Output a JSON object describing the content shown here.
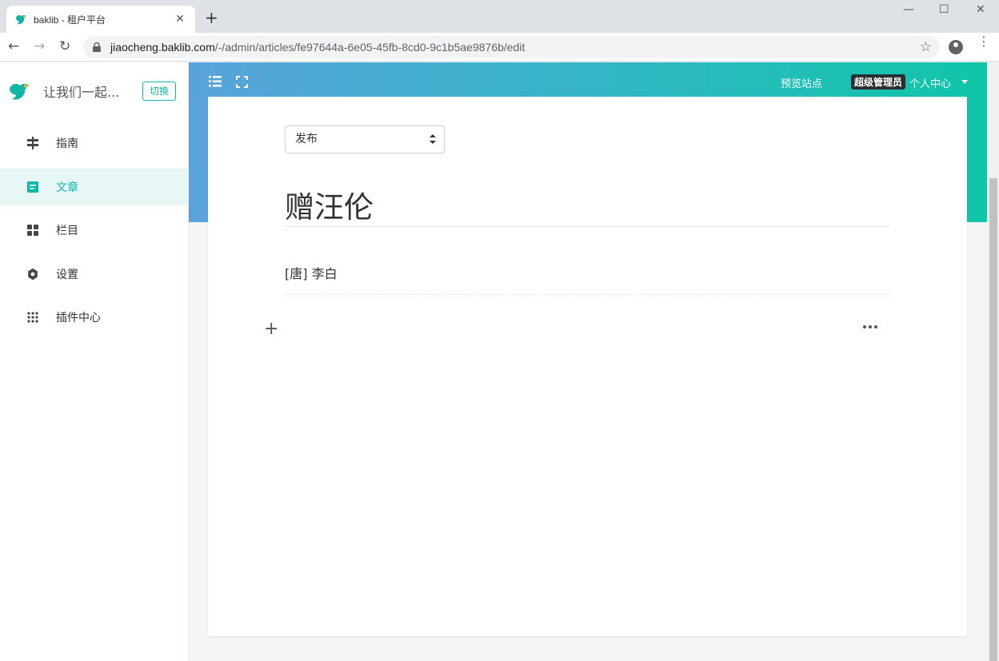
{
  "browser": {
    "tab_title": "baklib - 租户平台",
    "tab_close": "✕",
    "new_tab": "+",
    "url_host": "jiaocheng.baklib.com",
    "url_path": "/-/admin/articles/fe97644a-6e05-45fb-8cd0-9c1b5ae9876b/edit",
    "window_minimize": "—",
    "window_maximize": "☐",
    "window_close": "✕",
    "back": "←",
    "forward": "→",
    "reload": "↻",
    "bookmark_star": "☆",
    "menu": "⋮"
  },
  "sidebar": {
    "site_name": "让我们一起...",
    "switch_label": "切换",
    "items": [
      {
        "label": "指南",
        "icon": "signpost-icon"
      },
      {
        "label": "文章",
        "icon": "article-icon",
        "active": true
      },
      {
        "label": "栏目",
        "icon": "grid-icon"
      },
      {
        "label": "设置",
        "icon": "gear-icon"
      },
      {
        "label": "插件中心",
        "icon": "apps-icon"
      }
    ]
  },
  "header": {
    "preview_site": "预览站点",
    "admin_badge": "超级管理员",
    "personal_center": "个人中心"
  },
  "editor": {
    "status_value": "发布",
    "title": "赠汪伦",
    "author_line": "[唐] 李白",
    "add_block": "+"
  },
  "colors": {
    "accent": "#10b7a8",
    "gradient_start": "#5aa3dc",
    "gradient_end": "#0fc6a8"
  }
}
